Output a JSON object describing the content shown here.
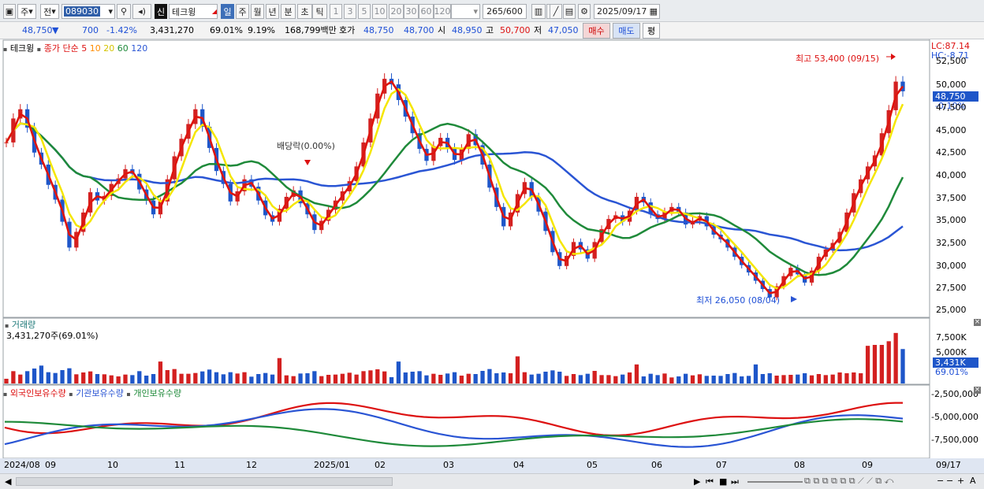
{
  "toolbar": {
    "period_select": "주",
    "prev_label": "전",
    "code": "089030",
    "market_badge": "신",
    "stock_name": "테크윙",
    "intervals": [
      "일",
      "주",
      "월",
      "년",
      "분",
      "초",
      "틱"
    ],
    "minutes": [
      "1",
      "3",
      "5",
      "10",
      "20",
      "30",
      "60",
      "120"
    ],
    "count": "265",
    "count_max": "/600",
    "date": "2025/09/17"
  },
  "quote": {
    "price": "48,750",
    "arrow": "▼",
    "change": "700",
    "rate": "-1.42%",
    "volume": "3,431,270",
    "vol_ratio": "69.01%",
    "turnover": "9.19%",
    "amount": "168,799백만",
    "bid_label": "호가",
    "ask1": "48,750",
    "bid1": "48,700",
    "open_label": "시",
    "open": "48,950",
    "high_label": "고",
    "high": "50,700",
    "low_label": "저",
    "low": "47,050",
    "buy_label": "매수",
    "sell_label": "매도",
    "eval_label": "평"
  },
  "legend": {
    "name": "테크윙",
    "ma_text": "종가 단순",
    "periods": [
      "5",
      "10",
      "20",
      "60",
      "120"
    ]
  },
  "annotations": {
    "high": "최고 53,400 (09/15)",
    "low": "최저 26,050 (08/04)",
    "dividend": "배당락(0.00%)",
    "lc": "LC:87.14",
    "hc": "HC:-8.71",
    "price_tag": "48,750",
    "price_pct": "-0.10%"
  },
  "price_axis": [
    "52,500",
    "50,000",
    "47,500",
    "45,000",
    "42,500",
    "40,000",
    "37,500",
    "35,000",
    "32,500",
    "30,000",
    "27,500",
    "25,000"
  ],
  "volume_panel": {
    "title": "거래량",
    "value": "3,431,270주(69.01%)",
    "axis": [
      "7,500K",
      "5,000K"
    ],
    "tag": "3,431K",
    "tag_pct": "69.01%"
  },
  "holding_panel": {
    "series": [
      "외국인보유수량",
      "기관보유수량",
      "개인보유수량"
    ],
    "axis": [
      "-2,500,000",
      "-5,000,000",
      "-7,500,000"
    ]
  },
  "date_axis": [
    "2024/08",
    "09",
    "10",
    "11",
    "12",
    "2025/01",
    "02",
    "03",
    "04",
    "05",
    "06",
    "07",
    "08",
    "09",
    "09/17"
  ],
  "colors": {
    "ma5": "#dd1111",
    "ma10": "#ff8c00",
    "ma20": "#f5e600",
    "ma60": "#1f8a3a",
    "ma120": "#2a55d4",
    "up": "#d32020",
    "down": "#1e56c9"
  },
  "chart_data": {
    "type": "candlestick",
    "period": "daily",
    "ylim": [
      25000,
      53400
    ],
    "high": {
      "value": 53400,
      "date": "09/15"
    },
    "low": {
      "value": 26050,
      "date": "08/04"
    },
    "last": {
      "open": 48950,
      "high": 50700,
      "low": 47050,
      "close": 48750,
      "volume": 3431270
    },
    "ma_periods": [
      5,
      10,
      20,
      60,
      120
    ],
    "closes": [
      43200,
      45800,
      46800,
      44800,
      42100,
      40800,
      38600,
      37000,
      34600,
      31800,
      33500,
      35600,
      37800,
      36900,
      37400,
      38700,
      39300,
      40300,
      39800,
      38100,
      36900,
      35400,
      36800,
      39200,
      41700,
      43600,
      45200,
      46800,
      44900,
      42600,
      40100,
      38700,
      36800,
      37900,
      39200,
      38400,
      36900,
      35300,
      34600,
      36000,
      37300,
      38000,
      36600,
      35400,
      33700,
      34700,
      35900,
      36900,
      37900,
      39000,
      40600,
      43200,
      45800,
      48500,
      50100,
      49500,
      47800,
      46000,
      44200,
      42500,
      41200,
      42800,
      43700,
      42600,
      41300,
      42500,
      44100,
      42900,
      40800,
      38300,
      36200,
      34100,
      35600,
      37600,
      38900,
      37300,
      35700,
      33600,
      31300,
      29800,
      30900,
      32400,
      31600,
      30600,
      32400,
      33800,
      34900,
      35300,
      34600,
      35800,
      37300,
      36700,
      35400,
      34900,
      35700,
      36200,
      35600,
      34300,
      34700,
      35200,
      34100,
      33200,
      32700,
      31800,
      30800,
      29900,
      29100,
      28200,
      27300,
      26400,
      27600,
      28700,
      29600,
      28900,
      28000,
      29300,
      30800,
      31600,
      32300,
      33500,
      35600,
      37700,
      39200,
      40600,
      41800,
      44200,
      46700,
      49800,
      48750
    ],
    "volume_note": "daily volume bars; last bar 3,431,270"
  }
}
